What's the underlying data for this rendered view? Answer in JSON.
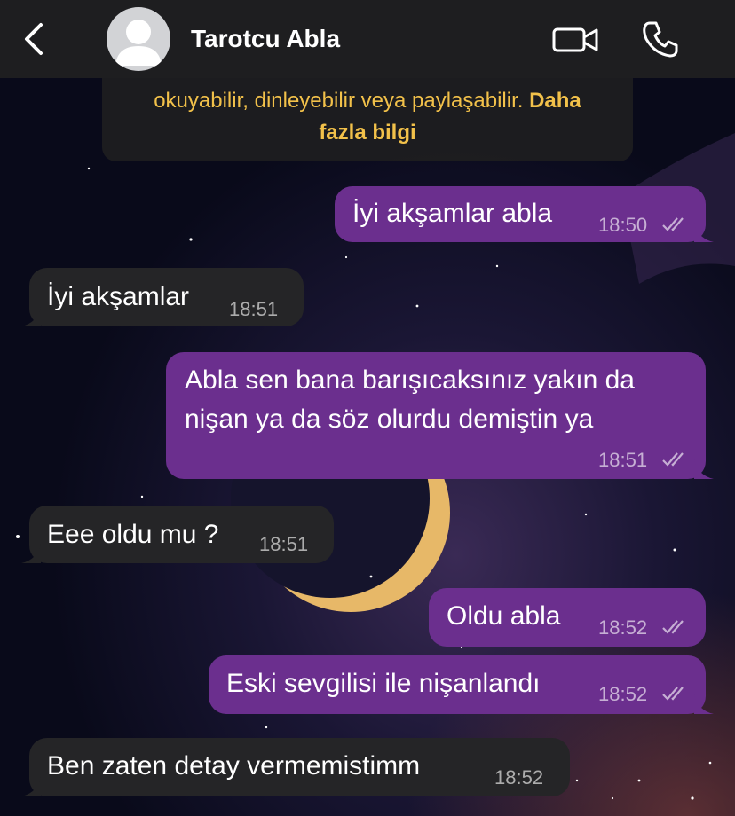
{
  "header": {
    "contact_name": "Tarotcu Abla"
  },
  "notice": {
    "line1_partial": "okuyabilir, dinleyebilir veya paylaşabilir.",
    "link_part1": "Daha",
    "link_part2": "fazla bilgi"
  },
  "messages": [
    {
      "direction": "out",
      "lines": [
        "İyi akşamlar abla"
      ],
      "time": "18:50",
      "status": "read"
    },
    {
      "direction": "in",
      "lines": [
        "İyi akşamlar"
      ],
      "time": "18:51"
    },
    {
      "direction": "out",
      "lines": [
        "Abla sen bana barışıcaksınız yakın da",
        "nişan ya da söz olurdu demiştin ya"
      ],
      "time": "18:51",
      "status": "read"
    },
    {
      "direction": "in",
      "lines": [
        "Eee oldu mu ?"
      ],
      "time": "18:51"
    },
    {
      "direction": "out",
      "lines": [
        "Oldu abla"
      ],
      "time": "18:52",
      "status": "read"
    },
    {
      "direction": "out",
      "lines": [
        "Eski sevgilisi ile nişanlandı"
      ],
      "time": "18:52",
      "status": "read"
    },
    {
      "direction": "in",
      "lines": [
        "Ben zaten detay vermemistimm"
      ],
      "time": "18:52"
    }
  ],
  "colors": {
    "outgoing_bubble": "#6b2f8e",
    "incoming_bubble": "#252527",
    "header_bg": "#1e1e20",
    "notice_text": "#f2c14a"
  }
}
